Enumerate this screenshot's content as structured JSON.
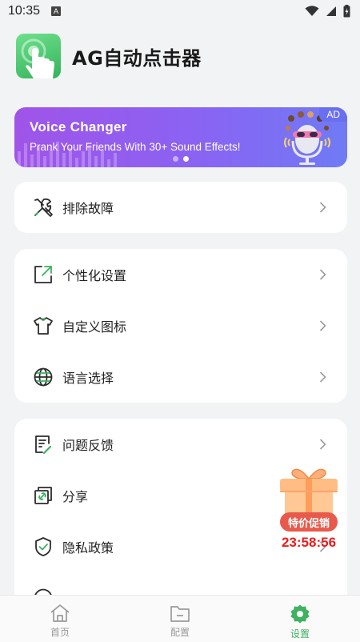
{
  "status_bar": {
    "time": "10:35",
    "notification_glyph": "A"
  },
  "app": {
    "title": "AG自动点击器"
  },
  "ad": {
    "title": "Voice Changer",
    "subtitle": "Prank Your Friends With 30+ Sound Effects!",
    "badge": "AD",
    "page_count": 2,
    "active_page": 2
  },
  "sections": {
    "troubleshoot": {
      "label": "排除故障"
    },
    "personalize": [
      {
        "key": "personal",
        "label": "个性化设置",
        "icon": "external-square-icon"
      },
      {
        "key": "custom_icon",
        "label": "自定义图标",
        "icon": "tshirt-icon"
      },
      {
        "key": "language",
        "label": "语言选择",
        "icon": "globe-icon"
      }
    ],
    "other": [
      {
        "key": "feedback",
        "label": "问题反馈",
        "icon": "feedback-doc-icon"
      },
      {
        "key": "share",
        "label": "分享",
        "icon": "share-link-icon"
      },
      {
        "key": "privacy",
        "label": "隐私政策",
        "icon": "shield-check-icon"
      }
    ]
  },
  "promo": {
    "label": "特价促销",
    "timer": "23:58:56"
  },
  "bottom_nav": [
    {
      "label": "首页",
      "icon": "home-icon",
      "active": false
    },
    {
      "label": "配置",
      "icon": "folder-icon",
      "active": false
    },
    {
      "label": "设置",
      "icon": "settings-gear-icon",
      "active": true
    }
  ],
  "colors": {
    "accent": "#3fb160",
    "ad_start": "#a054e8",
    "ad_end": "#6f7bf5",
    "timer": "#ee1c1c"
  }
}
